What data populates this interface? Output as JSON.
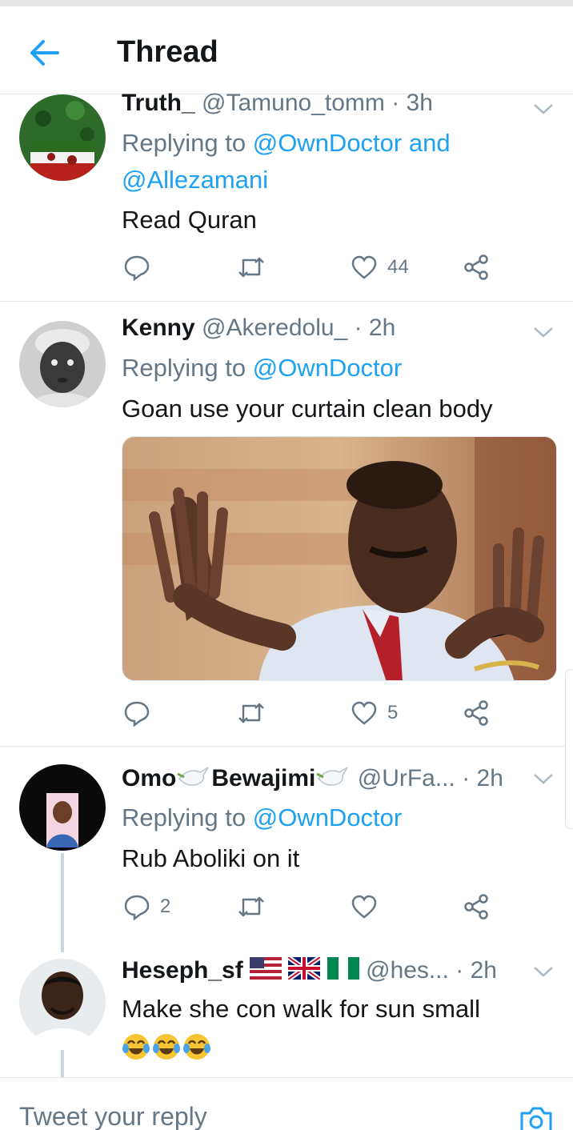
{
  "header": {
    "title": "Thread",
    "back_icon": "arrow-left-icon"
  },
  "colors": {
    "accent": "#1da1f2",
    "secondary": "#657786",
    "text": "#14171a",
    "divider": "#e1e8ed"
  },
  "tweets": [
    {
      "name": "Truth_",
      "handle": "@Tamuno_tomm",
      "time": "· 3h",
      "replying_prefix": "Replying to ",
      "replying_mentions_line1": "@OwnDoctor and",
      "replying_mentions_line2": "@Allezamani",
      "text": "Read Quran",
      "replies": "",
      "retweets": "",
      "likes": "44"
    },
    {
      "name": "Kenny",
      "handle": "@Akeredolu_",
      "time": "· 2h",
      "replying_prefix": "Replying to ",
      "replying_mentions": "@OwnDoctor",
      "text": "Goan use your curtain clean body",
      "media": "photo of man in white shirt and red tie raising both hands",
      "replies": "",
      "retweets": "",
      "likes": "5"
    },
    {
      "name_part1": "Omo",
      "name_part2": "Bewajimi",
      "handle": "@UrFa...",
      "time": "· 2h",
      "replying_prefix": "Replying to ",
      "replying_mentions": "@OwnDoctor",
      "text": "Rub Aboliki on it",
      "replies": "2",
      "retweets": "",
      "likes": ""
    },
    {
      "name": "Heseph_sf",
      "handle": "@hes...",
      "time": "· 2h",
      "text": "Make she con walk for   sun small"
    }
  ],
  "reply_bar": {
    "placeholder": "Tweet your reply"
  }
}
